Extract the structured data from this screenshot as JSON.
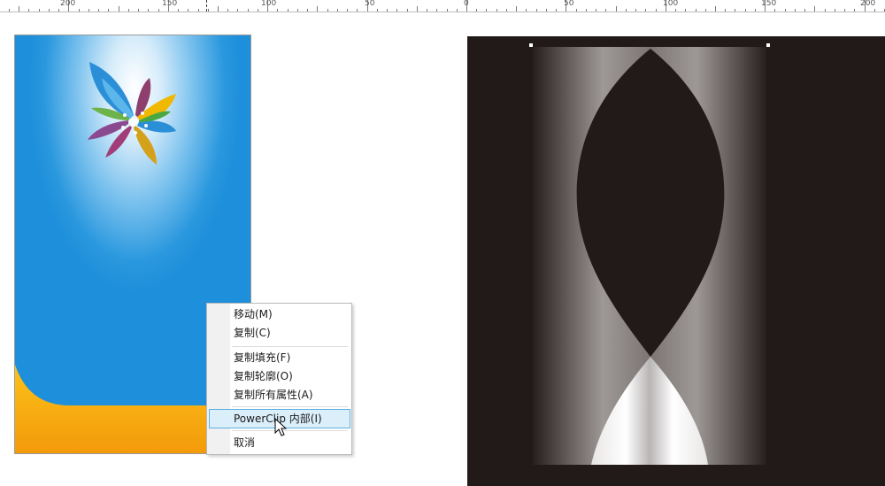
{
  "ruler": {
    "labels": [
      "200",
      "150",
      "100",
      "50",
      "0",
      "50",
      "100",
      "150",
      "200"
    ]
  },
  "context_menu": {
    "items": [
      {
        "label": "移动(M)"
      },
      {
        "label": "复制(C)"
      },
      {
        "label": "复制填充(F)"
      },
      {
        "label": "复制轮廓(O)"
      },
      {
        "label": "复制所有属性(A)"
      },
      {
        "label": "PowerClip 内部(I)"
      },
      {
        "label": "取消"
      }
    ],
    "highlighted_index": 5
  },
  "colors": {
    "card_blue": "#1e8fdb",
    "card_orange": "#f6a20c",
    "dark_bg": "#221a18",
    "menu_highlight": "#dbeffb"
  }
}
